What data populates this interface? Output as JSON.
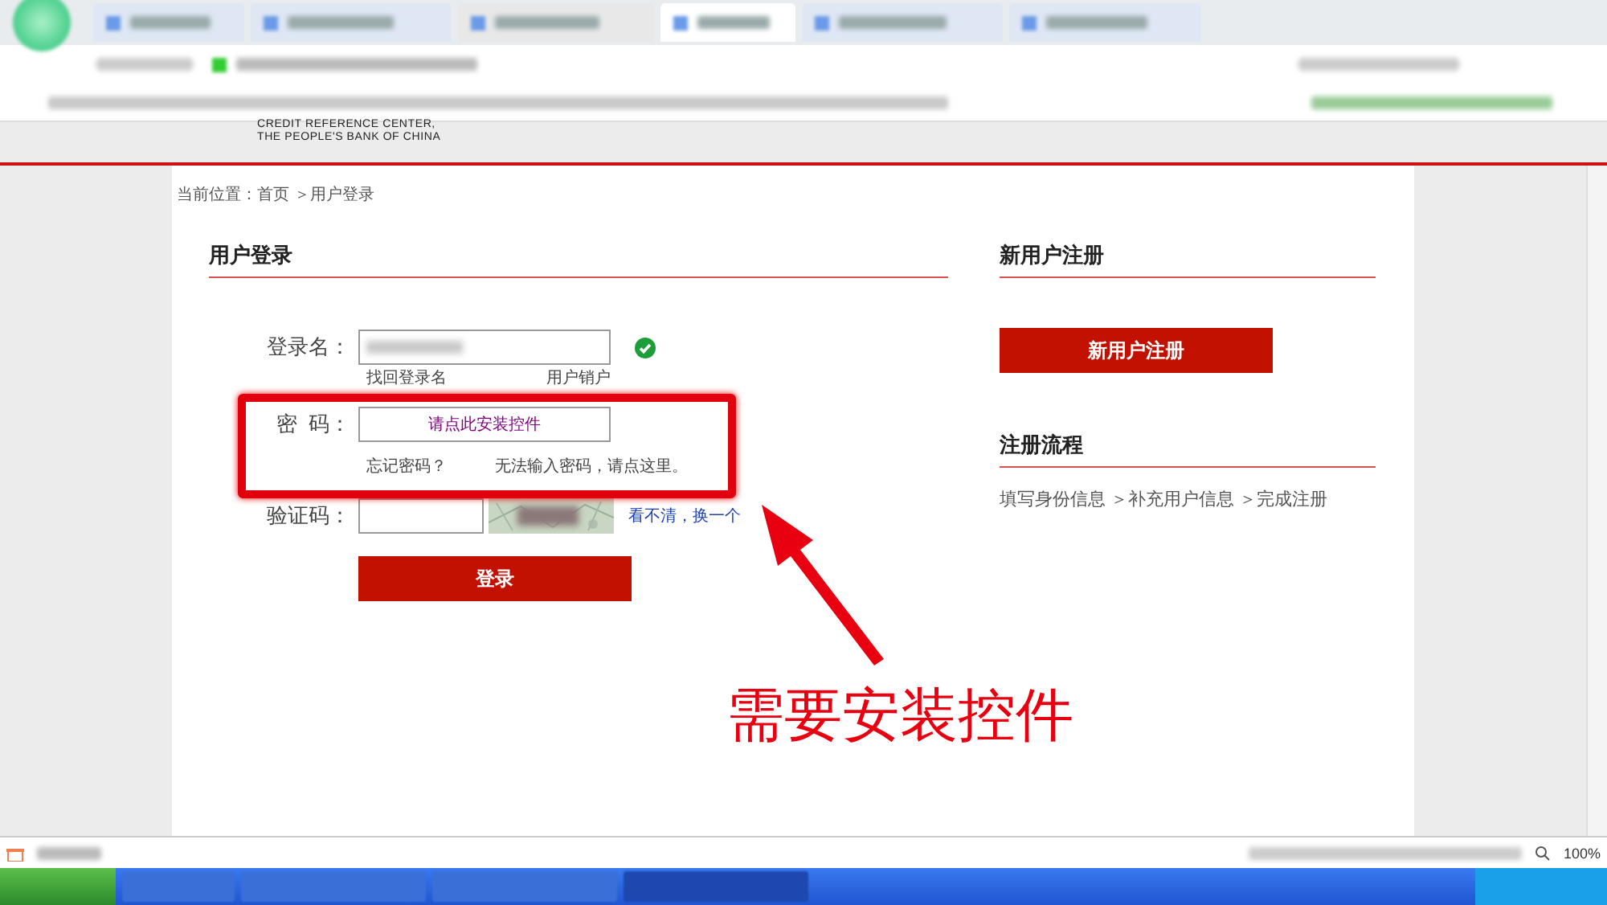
{
  "logo": {
    "lines": [
      "CREDIT REFERENCE CENTER,",
      "THE PEOPLE'S BANK OF CHINA"
    ]
  },
  "breadcrumb": "当前位置：首页 ＞用户登录",
  "login": {
    "title": "用户登录",
    "fields": [
      {
        "kind": "text",
        "label": "登录名：",
        "valid": true,
        "links": [
          "找回登录名",
          "用户销户"
        ]
      },
      {
        "kind": "plugin",
        "label": "密  码：",
        "value": "请点此安装控件",
        "links": [
          "忘记密码？",
          "无法输入密码，请点这里。"
        ]
      },
      {
        "kind": "captcha",
        "label": "验证码：",
        "refresh": "看不清，换一个"
      }
    ],
    "submit": "登录"
  },
  "register": {
    "title": "新用户注册",
    "button": "新用户注册",
    "flow_title": "注册流程",
    "steps": "填写身份信息 ＞补充用户信息 ＞完成注册"
  },
  "annotation": {
    "text": "需要安装控件"
  },
  "status_bar": {
    "zoom": "100%"
  }
}
